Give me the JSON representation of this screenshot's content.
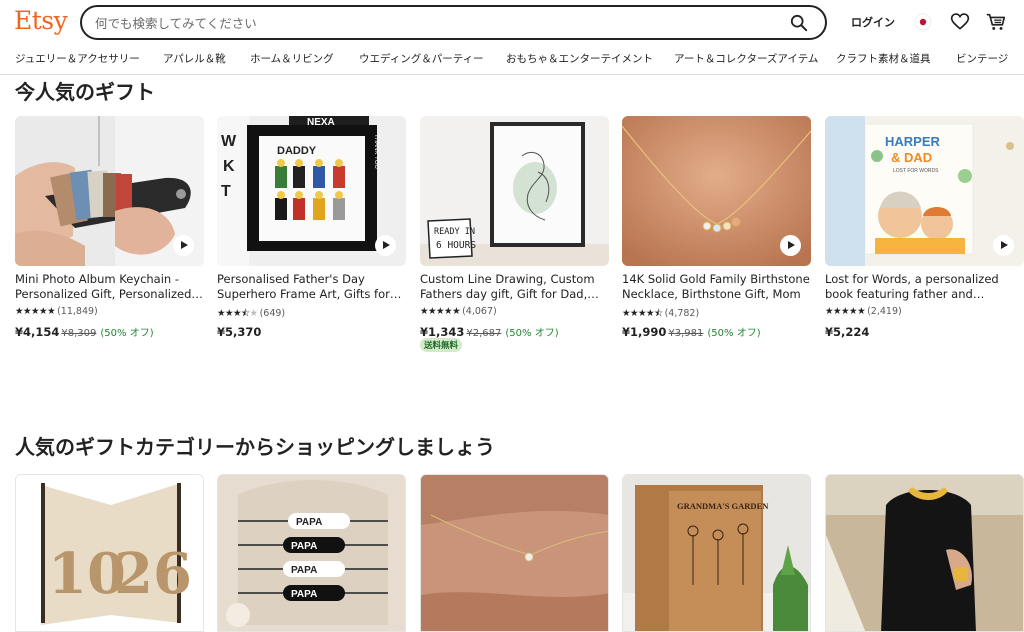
{
  "header": {
    "logo": "Etsy",
    "search_placeholder": "何でも検索してみてください",
    "login": "ログイン"
  },
  "nav": [
    "ジュエリー＆アクセサリー",
    "アパレル＆靴",
    "ホーム＆リビング",
    "ウエディング＆パーティー",
    "おもちゃ＆エンターテイメント",
    "アート＆コレクターズアイテム",
    "クラフト素材＆道具",
    "ビンテージ"
  ],
  "sections": {
    "popular_title": "今人気のギフト",
    "categories_title": "人気のギフトカテゴリーからショッピングしましょう"
  },
  "products": [
    {
      "title": "Mini Photo Album Keychain - Personalized Gift, Personalized Photo Album",
      "stars": 5,
      "count": "(11,849)",
      "price": "¥4,154",
      "original": "¥8,309",
      "discount": "(50% オフ)",
      "badge": ""
    },
    {
      "title": "Personalised Father's Day Superhero Frame Art, Gifts for Dad",
      "stars": 3.5,
      "count": "(649)",
      "price": "¥5,370",
      "original": "",
      "discount": "",
      "badge": ""
    },
    {
      "title": "Custom Line Drawing, Custom Fathers day gift, Gift for Dad, Portrait",
      "stars": 5,
      "count": "(4,067)",
      "price": "¥1,343",
      "original": "¥2,687",
      "discount": "(50% オフ)",
      "badge": "送料無料"
    },
    {
      "title": "14K Solid Gold Family Birthstone Necklace, Birthstone Gift, Mom",
      "stars": 4.5,
      "count": "(4,782)",
      "price": "¥1,990",
      "original": "¥3,981",
      "discount": "(50% オフ)",
      "badge": ""
    },
    {
      "title": "Lost for Words, a personalized book featuring father and children",
      "stars": 5,
      "count": "(2,419)",
      "price": "¥5,224",
      "original": "",
      "discount": "",
      "badge": ""
    }
  ],
  "book_cover": {
    "line1": "HARPER",
    "line2": "& DAD",
    "sub": "LOST FOR WORDS"
  },
  "frame_text": {
    "brand": "NEXA",
    "label": "DADDY",
    "side": "THANK YOU"
  },
  "drawing_sign": {
    "line1": "READY IN",
    "line2": "6 HOURS"
  },
  "categories": [
    "book-art",
    "papa-bracelets",
    "anklet",
    "grandmas-garden-box",
    "gold-jewelry"
  ],
  "cat_texts": {
    "papa": "PAPA",
    "book": "GRANDMA'S GARDEN"
  },
  "colors": {
    "brand": "#f1641e",
    "discount": "#258635",
    "ship_bg": "#d4e9c9"
  }
}
